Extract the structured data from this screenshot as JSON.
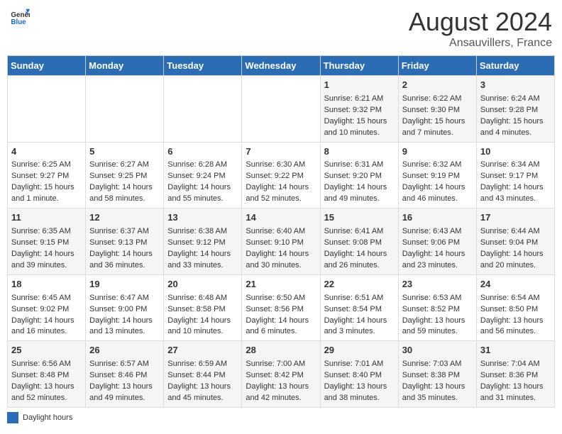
{
  "header": {
    "logo_general": "General",
    "logo_blue": "Blue",
    "main_title": "August 2024",
    "subtitle": "Ansauvillers, France"
  },
  "weekdays": [
    "Sunday",
    "Monday",
    "Tuesday",
    "Wednesday",
    "Thursday",
    "Friday",
    "Saturday"
  ],
  "legend_label": "Daylight hours",
  "weeks": [
    [
      {
        "day": "",
        "info": ""
      },
      {
        "day": "",
        "info": ""
      },
      {
        "day": "",
        "info": ""
      },
      {
        "day": "",
        "info": ""
      },
      {
        "day": "1",
        "info": "Sunrise: 6:21 AM\nSunset: 9:32 PM\nDaylight: 15 hours\nand 10 minutes."
      },
      {
        "day": "2",
        "info": "Sunrise: 6:22 AM\nSunset: 9:30 PM\nDaylight: 15 hours\nand 7 minutes."
      },
      {
        "day": "3",
        "info": "Sunrise: 6:24 AM\nSunset: 9:28 PM\nDaylight: 15 hours\nand 4 minutes."
      }
    ],
    [
      {
        "day": "4",
        "info": "Sunrise: 6:25 AM\nSunset: 9:27 PM\nDaylight: 15 hours\nand 1 minute."
      },
      {
        "day": "5",
        "info": "Sunrise: 6:27 AM\nSunset: 9:25 PM\nDaylight: 14 hours\nand 58 minutes."
      },
      {
        "day": "6",
        "info": "Sunrise: 6:28 AM\nSunset: 9:24 PM\nDaylight: 14 hours\nand 55 minutes."
      },
      {
        "day": "7",
        "info": "Sunrise: 6:30 AM\nSunset: 9:22 PM\nDaylight: 14 hours\nand 52 minutes."
      },
      {
        "day": "8",
        "info": "Sunrise: 6:31 AM\nSunset: 9:20 PM\nDaylight: 14 hours\nand 49 minutes."
      },
      {
        "day": "9",
        "info": "Sunrise: 6:32 AM\nSunset: 9:19 PM\nDaylight: 14 hours\nand 46 minutes."
      },
      {
        "day": "10",
        "info": "Sunrise: 6:34 AM\nSunset: 9:17 PM\nDaylight: 14 hours\nand 43 minutes."
      }
    ],
    [
      {
        "day": "11",
        "info": "Sunrise: 6:35 AM\nSunset: 9:15 PM\nDaylight: 14 hours\nand 39 minutes."
      },
      {
        "day": "12",
        "info": "Sunrise: 6:37 AM\nSunset: 9:13 PM\nDaylight: 14 hours\nand 36 minutes."
      },
      {
        "day": "13",
        "info": "Sunrise: 6:38 AM\nSunset: 9:12 PM\nDaylight: 14 hours\nand 33 minutes."
      },
      {
        "day": "14",
        "info": "Sunrise: 6:40 AM\nSunset: 9:10 PM\nDaylight: 14 hours\nand 30 minutes."
      },
      {
        "day": "15",
        "info": "Sunrise: 6:41 AM\nSunset: 9:08 PM\nDaylight: 14 hours\nand 26 minutes."
      },
      {
        "day": "16",
        "info": "Sunrise: 6:43 AM\nSunset: 9:06 PM\nDaylight: 14 hours\nand 23 minutes."
      },
      {
        "day": "17",
        "info": "Sunrise: 6:44 AM\nSunset: 9:04 PM\nDaylight: 14 hours\nand 20 minutes."
      }
    ],
    [
      {
        "day": "18",
        "info": "Sunrise: 6:45 AM\nSunset: 9:02 PM\nDaylight: 14 hours\nand 16 minutes."
      },
      {
        "day": "19",
        "info": "Sunrise: 6:47 AM\nSunset: 9:00 PM\nDaylight: 14 hours\nand 13 minutes."
      },
      {
        "day": "20",
        "info": "Sunrise: 6:48 AM\nSunset: 8:58 PM\nDaylight: 14 hours\nand 10 minutes."
      },
      {
        "day": "21",
        "info": "Sunrise: 6:50 AM\nSunset: 8:56 PM\nDaylight: 14 hours\nand 6 minutes."
      },
      {
        "day": "22",
        "info": "Sunrise: 6:51 AM\nSunset: 8:54 PM\nDaylight: 14 hours\nand 3 minutes."
      },
      {
        "day": "23",
        "info": "Sunrise: 6:53 AM\nSunset: 8:52 PM\nDaylight: 13 hours\nand 59 minutes."
      },
      {
        "day": "24",
        "info": "Sunrise: 6:54 AM\nSunset: 8:50 PM\nDaylight: 13 hours\nand 56 minutes."
      }
    ],
    [
      {
        "day": "25",
        "info": "Sunrise: 6:56 AM\nSunset: 8:48 PM\nDaylight: 13 hours\nand 52 minutes."
      },
      {
        "day": "26",
        "info": "Sunrise: 6:57 AM\nSunset: 8:46 PM\nDaylight: 13 hours\nand 49 minutes."
      },
      {
        "day": "27",
        "info": "Sunrise: 6:59 AM\nSunset: 8:44 PM\nDaylight: 13 hours\nand 45 minutes."
      },
      {
        "day": "28",
        "info": "Sunrise: 7:00 AM\nSunset: 8:42 PM\nDaylight: 13 hours\nand 42 minutes."
      },
      {
        "day": "29",
        "info": "Sunrise: 7:01 AM\nSunset: 8:40 PM\nDaylight: 13 hours\nand 38 minutes."
      },
      {
        "day": "30",
        "info": "Sunrise: 7:03 AM\nSunset: 8:38 PM\nDaylight: 13 hours\nand 35 minutes."
      },
      {
        "day": "31",
        "info": "Sunrise: 7:04 AM\nSunset: 8:36 PM\nDaylight: 13 hours\nand 31 minutes."
      }
    ]
  ]
}
